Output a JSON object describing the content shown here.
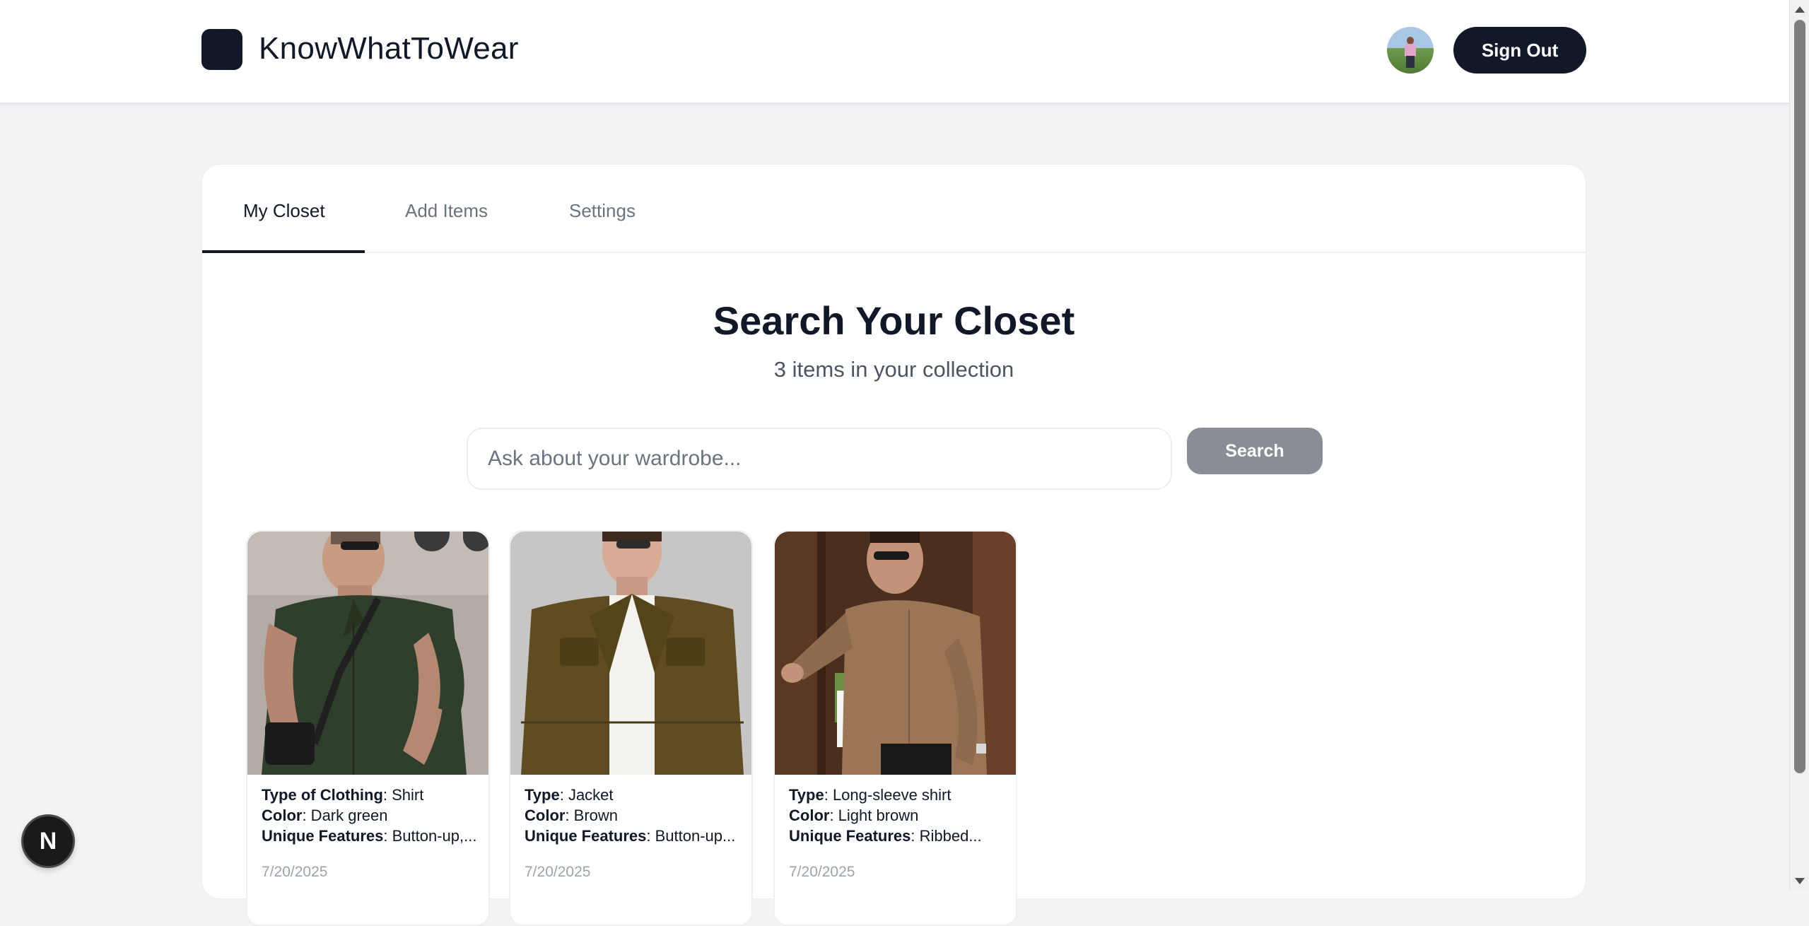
{
  "header": {
    "app_title": "KnowWhatToWear",
    "sign_out_label": "Sign Out"
  },
  "tabs": [
    {
      "label": "My Closet",
      "active": true
    },
    {
      "label": "Add Items",
      "active": false
    },
    {
      "label": "Settings",
      "active": false
    }
  ],
  "search": {
    "title": "Search Your Closet",
    "subtitle": "3 items in your collection",
    "placeholder": "Ask about your wardrobe...",
    "value": "",
    "button_label": "Search"
  },
  "items": [
    {
      "type_label": "Type of Clothing",
      "type_value": ": Shirt",
      "color_label": "Color",
      "color_value": ": Dark green",
      "features_label": "Unique Features",
      "features_value": ": Button-up,...",
      "date": "7/20/2025"
    },
    {
      "type_label": "Type",
      "type_value": ": Jacket",
      "color_label": "Color",
      "color_value": ": Brown",
      "features_label": "Unique Features",
      "features_value": ": Button-up...",
      "date": "7/20/2025"
    },
    {
      "type_label": "Type",
      "type_value": ": Long-sleeve shirt",
      "color_label": "Color",
      "color_value": ": Light brown",
      "features_label": "Unique Features",
      "features_value": ": Ribbed...",
      "date": "7/20/2025"
    }
  ],
  "dev_badge": {
    "letter": "N"
  },
  "icons": {
    "logo": "logo-square-icon",
    "share": "share-icon",
    "scroll_up": "chevron-up-icon",
    "scroll_down": "chevron-down-icon"
  },
  "colors": {
    "primary": "#111827",
    "search_button": "#8a8d96",
    "background": "#f2f3f5"
  }
}
